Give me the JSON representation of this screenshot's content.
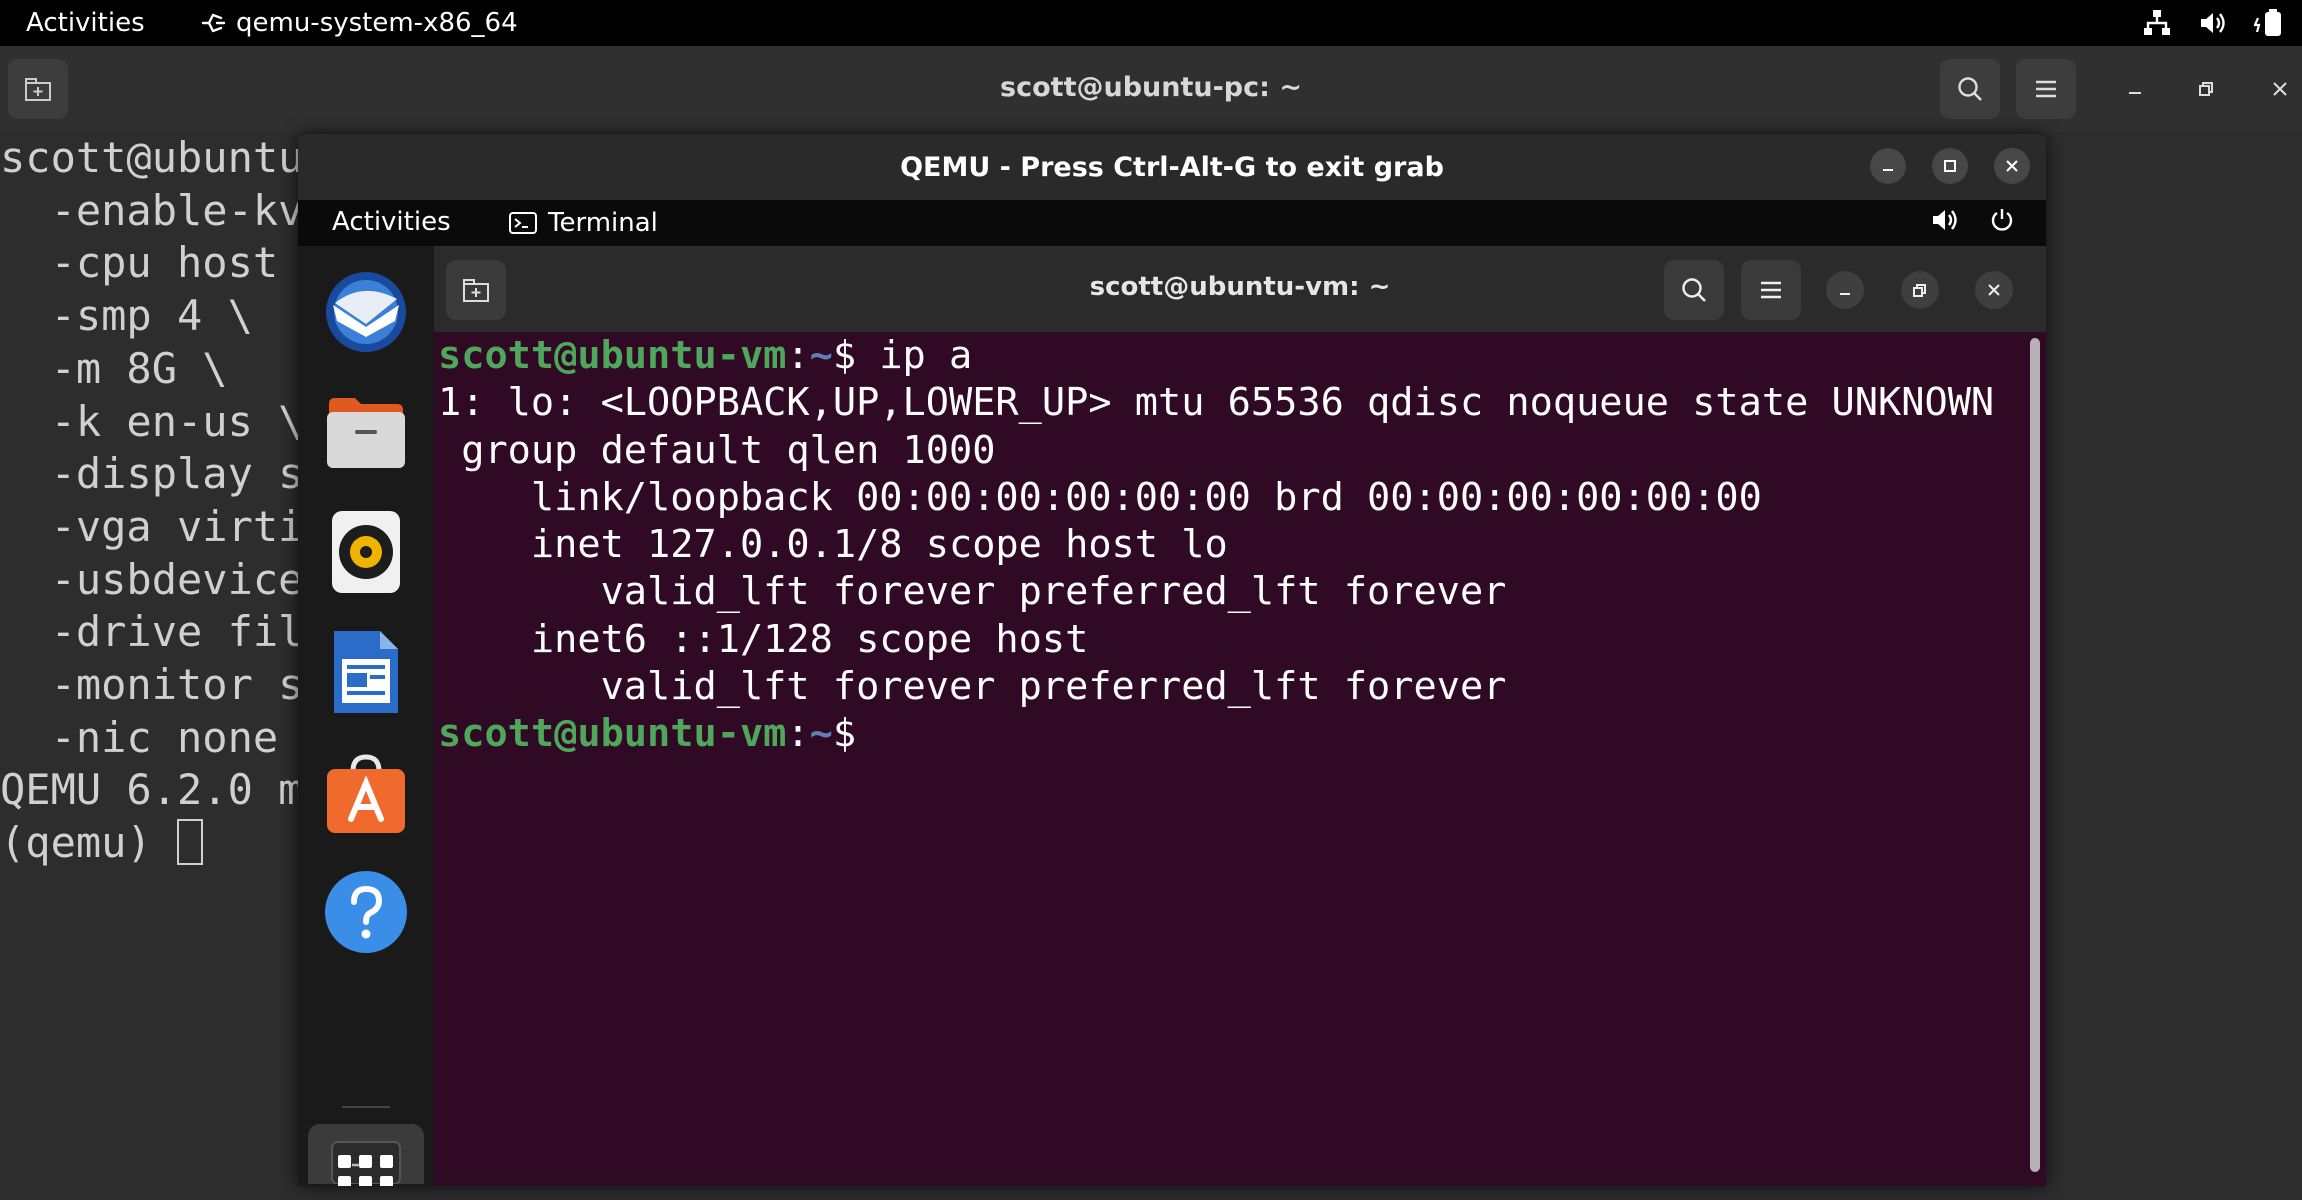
{
  "host_topbar": {
    "activities": "Activities",
    "app_name": "qemu-system-x86_64",
    "tray_icons": [
      "network-icon",
      "volume-icon",
      "battery-icon"
    ]
  },
  "host_terminal": {
    "title": "scott@ubuntu-pc: ~",
    "lines": [
      "scott@ubuntu",
      "  -enable-kv",
      "  -cpu host",
      "  -smp 4 \\",
      "  -m 8G \\",
      "  -k en-us \\",
      "  -display s",
      "  -vga virti",
      "  -usbdevice",
      "  -drive fil",
      "  -monitor s",
      "  -nic none",
      "QEMU 6.2.0 m"
    ],
    "prompt": "(qemu) "
  },
  "qemu_window": {
    "title": "QEMU - Press Ctrl-Alt-G to exit grab"
  },
  "guest_topbar": {
    "activities": "Activities",
    "app_name": "Terminal"
  },
  "dock": {
    "items": [
      "thunderbird-icon",
      "files-icon",
      "rhythmbox-icon",
      "writer-icon",
      "software-icon",
      "help-icon",
      "terminal-icon",
      "show-apps-icon"
    ]
  },
  "guest_terminal": {
    "title": "scott@ubuntu-vm: ~",
    "prompt_user": "scott@ubuntu-vm",
    "prompt_colon": ":",
    "prompt_path": "~",
    "prompt_dollar": "$ ",
    "command": "ip a",
    "output": [
      "1: lo: <LOOPBACK,UP,LOWER_UP> mtu 65536 qdisc noqueue state UNKNOWN",
      " group default qlen 1000",
      "    link/loopback 00:00:00:00:00:00 brd 00:00:00:00:00:00",
      "    inet 127.0.0.1/8 scope host lo",
      "       valid_lft forever preferred_lft forever",
      "    inet6 ::1/128 scope host",
      "       valid_lft forever preferred_lft forever"
    ]
  },
  "colors": {
    "guest_bg": "#300a24",
    "prompt_green": "#4ea75a",
    "prompt_blue": "#5f7fba"
  }
}
